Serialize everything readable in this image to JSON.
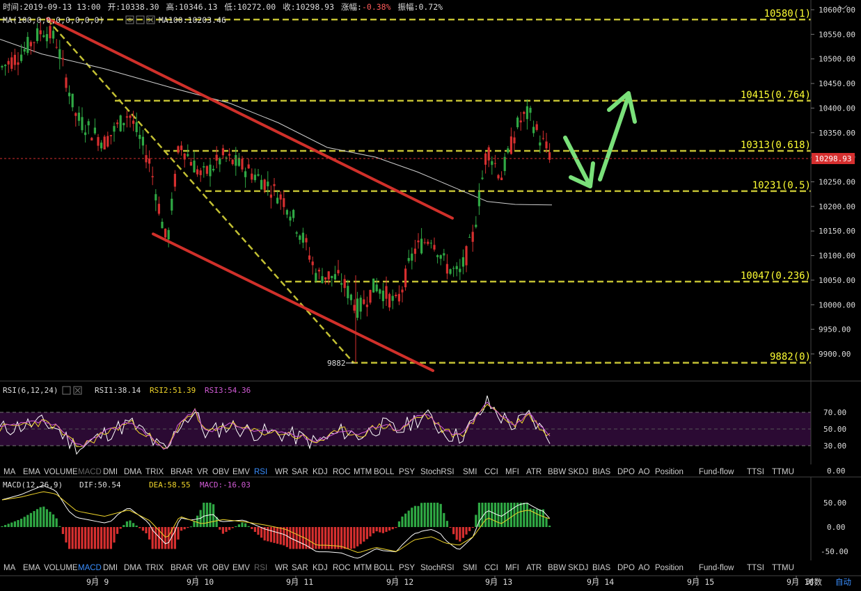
{
  "info_bar": {
    "time_label": "时间:",
    "time": "2019-09-13 13:00",
    "open_label": "开:",
    "open": "10338.30",
    "high_label": "高:",
    "high": "10346.13",
    "low_label": "低:",
    "low": "10272.00",
    "close_label": "收:",
    "close": "10298.93",
    "change_label": "涨幅:",
    "change": "-0.38%",
    "amplitude_label": "振幅:",
    "amplitude": "0.72%"
  },
  "ma_legend": {
    "params": "MA(100,0,0,0,0,0,0,0)",
    "ma100": "MA100:10203.46"
  },
  "price_axis_ticks": [
    "10600.00",
    "10550.00",
    "10500.00",
    "10450.00",
    "10400.00",
    "10350.00",
    "10300.00",
    "10250.00",
    "10200.00",
    "10150.00",
    "10100.00",
    "10050.00",
    "10000.00",
    "9950.00",
    "9900.00"
  ],
  "current_price_tag": "10298.93",
  "low_marker": "9882",
  "fib_levels": [
    {
      "label": "10580(1)",
      "price": 10580
    },
    {
      "label": "10415(0.764)",
      "price": 10415
    },
    {
      "label": "10313(0.618)",
      "price": 10313
    },
    {
      "label": "10231(0.5)",
      "price": 10231
    },
    {
      "label": "10047(0.236)",
      "price": 10047
    },
    {
      "label": "9882(0)",
      "price": 9882
    }
  ],
  "rsi_panel": {
    "title": "RSI(6,12,24)",
    "rsi1": "RSI1:38.14",
    "rsi2": "RSI2:51.39",
    "rsi3": "RSI3:54.36",
    "ticks": [
      "70.00",
      "50.00",
      "30.00",
      "0.00"
    ]
  },
  "macd_panel": {
    "title": "MACD(12,26,9)",
    "dif": "DIF:50.54",
    "dea": "DEA:58.55",
    "macd": "MACD:-16.03",
    "ticks": [
      "50.00",
      "0.00",
      "-50.00"
    ]
  },
  "indicator_tabs_rsi": [
    "MA",
    "EMA",
    "VOLUME",
    "MACD",
    "DMI",
    "DMA",
    "TRIX",
    "BRAR",
    "VR",
    "OBV",
    "EMV",
    "RSI",
    "WR",
    "SAR",
    "KDJ",
    "ROC",
    "MTM",
    "BOLL",
    "PSY",
    "StochRSI",
    "SMI",
    "CCI",
    "MFI",
    "ATR",
    "BBW",
    "SKDJ",
    "BIAS",
    "DPO",
    "AO",
    "Position",
    "Fund-flow",
    "TTSI",
    "TTMU"
  ],
  "indicator_tabs_macd": [
    "MA",
    "EMA",
    "VOLUME",
    "MACD",
    "DMI",
    "DMA",
    "TRIX",
    "BRAR",
    "VR",
    "OBV",
    "EMV",
    "RSI",
    "WR",
    "SAR",
    "KDJ",
    "ROC",
    "MTM",
    "BOLL",
    "PSY",
    "StochRSI",
    "SMI",
    "CCI",
    "MFI",
    "ATR",
    "BBW",
    "SKDJ",
    "BIAS",
    "DPO",
    "AO",
    "Position",
    "Fund-flow",
    "TTSI",
    "TTMU"
  ],
  "dates": [
    "9月 9",
    "9月 10",
    "9月 11",
    "9月 12",
    "9月 13",
    "9月 14",
    "9月 15",
    "9月 16"
  ],
  "time_axis_suffix": "时数",
  "auto_button": "自动",
  "colors": {
    "up": "#2fa844",
    "down": "#d62f2f",
    "fib": "#c3c033",
    "fib_text": "#ffff33",
    "trend": "#d0302a",
    "arrow": "#7ae07a",
    "rsi_band": "#2b0a33",
    "rsi2": "#f0d52a",
    "rsi3": "#d25bd6",
    "dea": "#f0d52a"
  },
  "chart_data": {
    "type": "candlestick",
    "y_range": [
      9860,
      10610
    ],
    "x_labels": [
      "9月 9",
      "9月 10",
      "9月 11",
      "9月 12",
      "9月 13",
      "9月 14",
      "9月 15",
      "9月 16"
    ],
    "ma100_last": 10203.46,
    "fib_retracement": [
      10580,
      10415,
      10313,
      10231,
      10047,
      9882
    ],
    "swing_low": 9882,
    "rsi": {
      "rsi1": 38.14,
      "rsi2": 51.39,
      "rsi3": 54.36,
      "levels": [
        70,
        50,
        30
      ]
    },
    "macd": {
      "dif": 50.54,
      "dea": 58.55,
      "macd": -16.03
    }
  }
}
